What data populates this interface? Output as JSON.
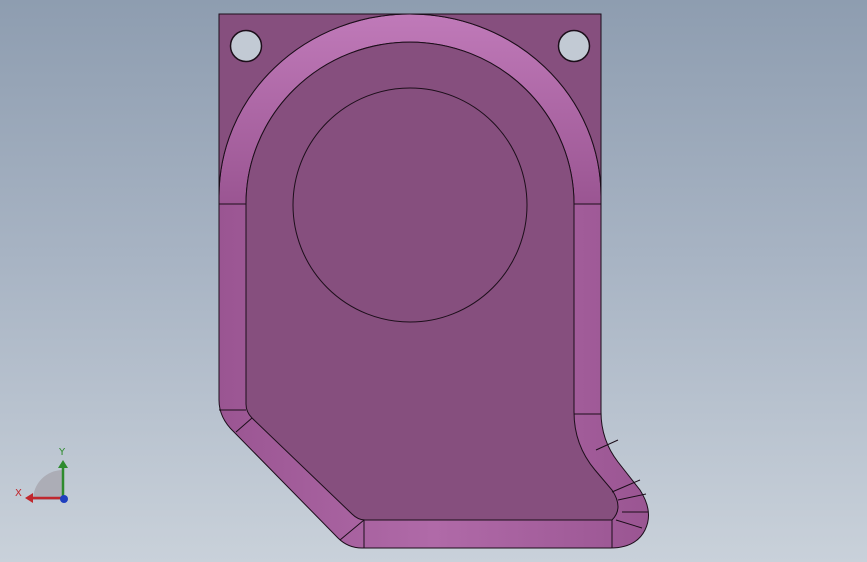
{
  "viewport": {
    "background_top": "#8e9db0",
    "background_bottom": "#c9d1da"
  },
  "part": {
    "face_color": "#864f7e",
    "fillet_color": "#a05a98",
    "highlight_color": "#b56bae",
    "edge_color": "#1c0e1a"
  },
  "triad": {
    "x_label": "X",
    "y_label": "Y",
    "x_color": "#c0272d",
    "y_color": "#2e8b2e",
    "z_color": "#1f3fbf"
  }
}
